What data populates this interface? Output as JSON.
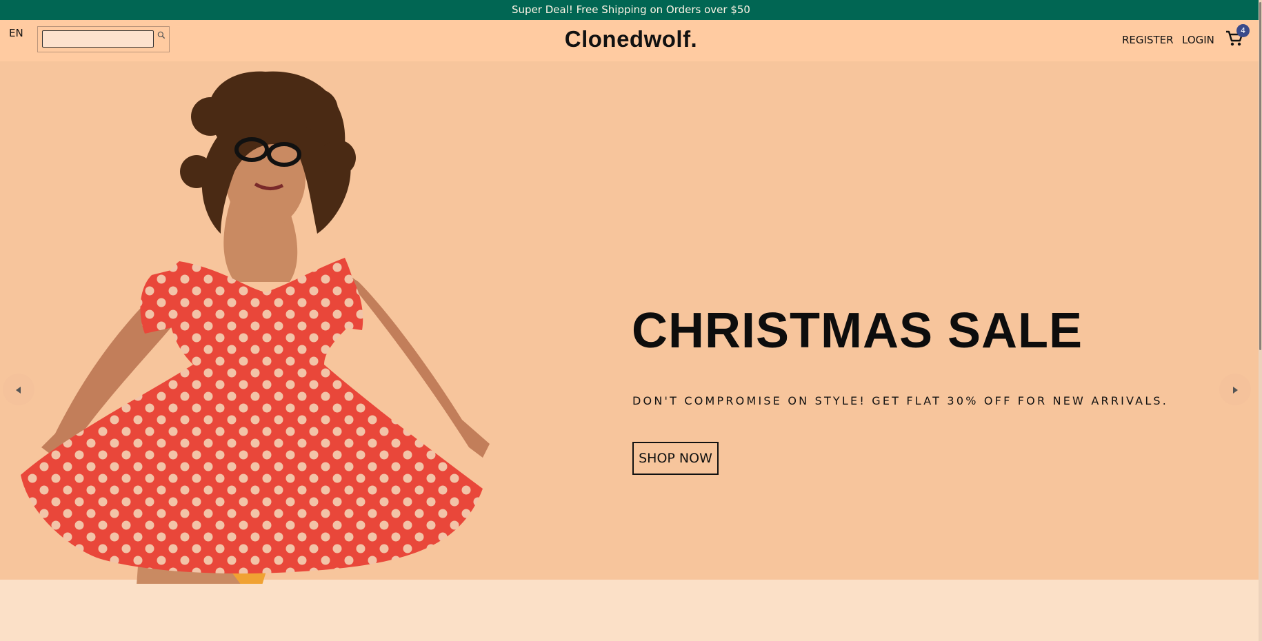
{
  "announcement": {
    "text": "Super Deal! Free Shipping on Orders over $50"
  },
  "navbar": {
    "language": "EN",
    "search": {
      "placeholder": "",
      "value": ""
    },
    "logo": "Clonedwolf.",
    "links": {
      "register": "REGISTER",
      "login": "LOGIN"
    },
    "cart": {
      "count": "4"
    }
  },
  "hero": {
    "title": "CHRISTMAS SALE",
    "subtitle": "DON'T COMPROMISE ON STYLE! GET FLAT 30% OFF FOR NEW ARRIVALS.",
    "cta": "SHOP NOW",
    "background_color": "#f7c59c"
  },
  "colors": {
    "announcement_bg": "#016653",
    "navbar_bg": "#ffcba1",
    "badge": "#3a4a8a"
  },
  "icons": [
    "search-icon",
    "cart-icon",
    "arrow-left-icon",
    "arrow-right-icon"
  ]
}
